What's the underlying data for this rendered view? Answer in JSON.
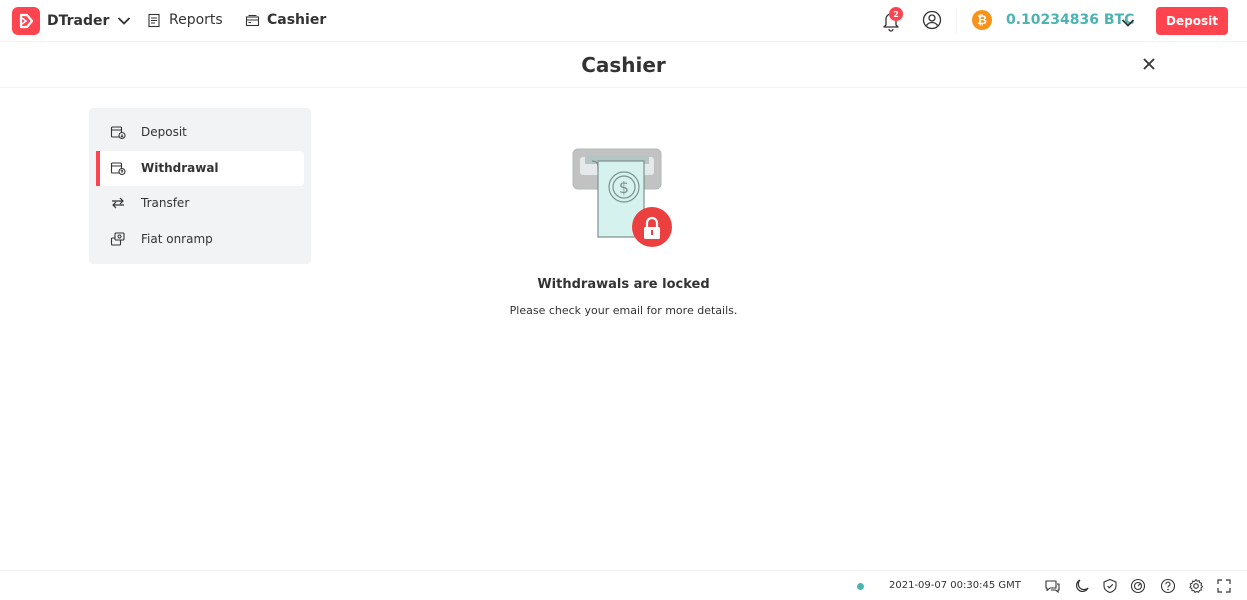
{
  "header": {
    "app_name": "DTrader",
    "nav": {
      "reports": "Reports",
      "cashier": "Cashier"
    },
    "notifications_count": "2",
    "balance": "0.10234836 BTC",
    "deposit_label": "Deposit",
    "currency_icon": "bitcoin-icon"
  },
  "page": {
    "title": "Cashier"
  },
  "sidebar": {
    "items": [
      {
        "label": "Deposit",
        "icon": "deposit-icon"
      },
      {
        "label": "Withdrawal",
        "icon": "withdrawal-icon",
        "active": true
      },
      {
        "label": "Transfer",
        "icon": "transfer-icon"
      },
      {
        "label": "Fiat onramp",
        "icon": "fiat-onramp-icon"
      }
    ]
  },
  "main": {
    "message_title": "Withdrawals are locked",
    "message_text": "Please check your email for more details."
  },
  "footer": {
    "timestamp": "2021-09-07 00:30:45 GMT",
    "icons": [
      "chat-icon",
      "theme-icon",
      "security-icon",
      "responsible-trading-icon",
      "help-icon",
      "settings-icon",
      "fullscreen-icon"
    ]
  },
  "colors": {
    "brand": "#ff444f",
    "balance": "#4bb4b3",
    "panel": "#f2f3f4"
  }
}
